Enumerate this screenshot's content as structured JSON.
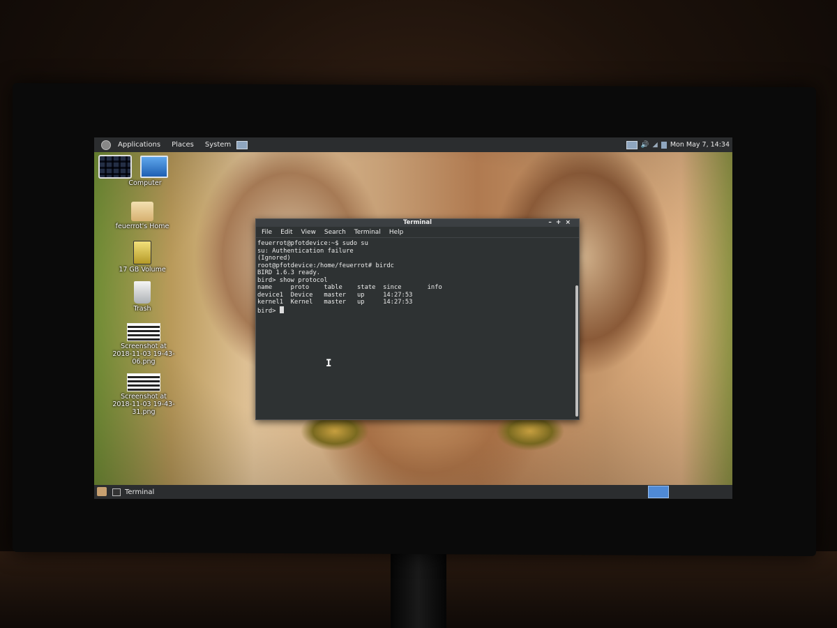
{
  "top_panel": {
    "menus": [
      "Applications",
      "Places",
      "System"
    ],
    "clock": "Mon May  7, 14:34"
  },
  "desktop_icons": [
    {
      "label": "Computer",
      "icon": "computer-icon"
    },
    {
      "label": "feuerrot's Home",
      "icon": "home-folder-icon"
    },
    {
      "label": "17 GB Volume",
      "icon": "drive-icon"
    },
    {
      "label": "Trash",
      "icon": "trash-icon"
    },
    {
      "label": "Screenshot at 2018-11-03 19-43-06.png",
      "icon": "image-file-icon"
    },
    {
      "label": "Screenshot at 2018-11-03 19-43-31.png",
      "icon": "image-file-icon"
    }
  ],
  "terminal": {
    "title": "Terminal",
    "menu": [
      "File",
      "Edit",
      "View",
      "Search",
      "Terminal",
      "Help"
    ],
    "lines": [
      "feuerrot@pfotdevice:~$ sudo su",
      "su: Authentication failure",
      "(Ignored)",
      "root@pfotdevice:/home/feuerrot# birdc",
      "BIRD 1.6.3 ready.",
      "bird> show protocol",
      "name     proto    table    state  since       info",
      "device1  Device   master   up     14:27:53",
      "kernel1  Kernel   master   up     14:27:53"
    ],
    "prompt": "bird> "
  },
  "bottom_panel": {
    "task": "Terminal"
  }
}
